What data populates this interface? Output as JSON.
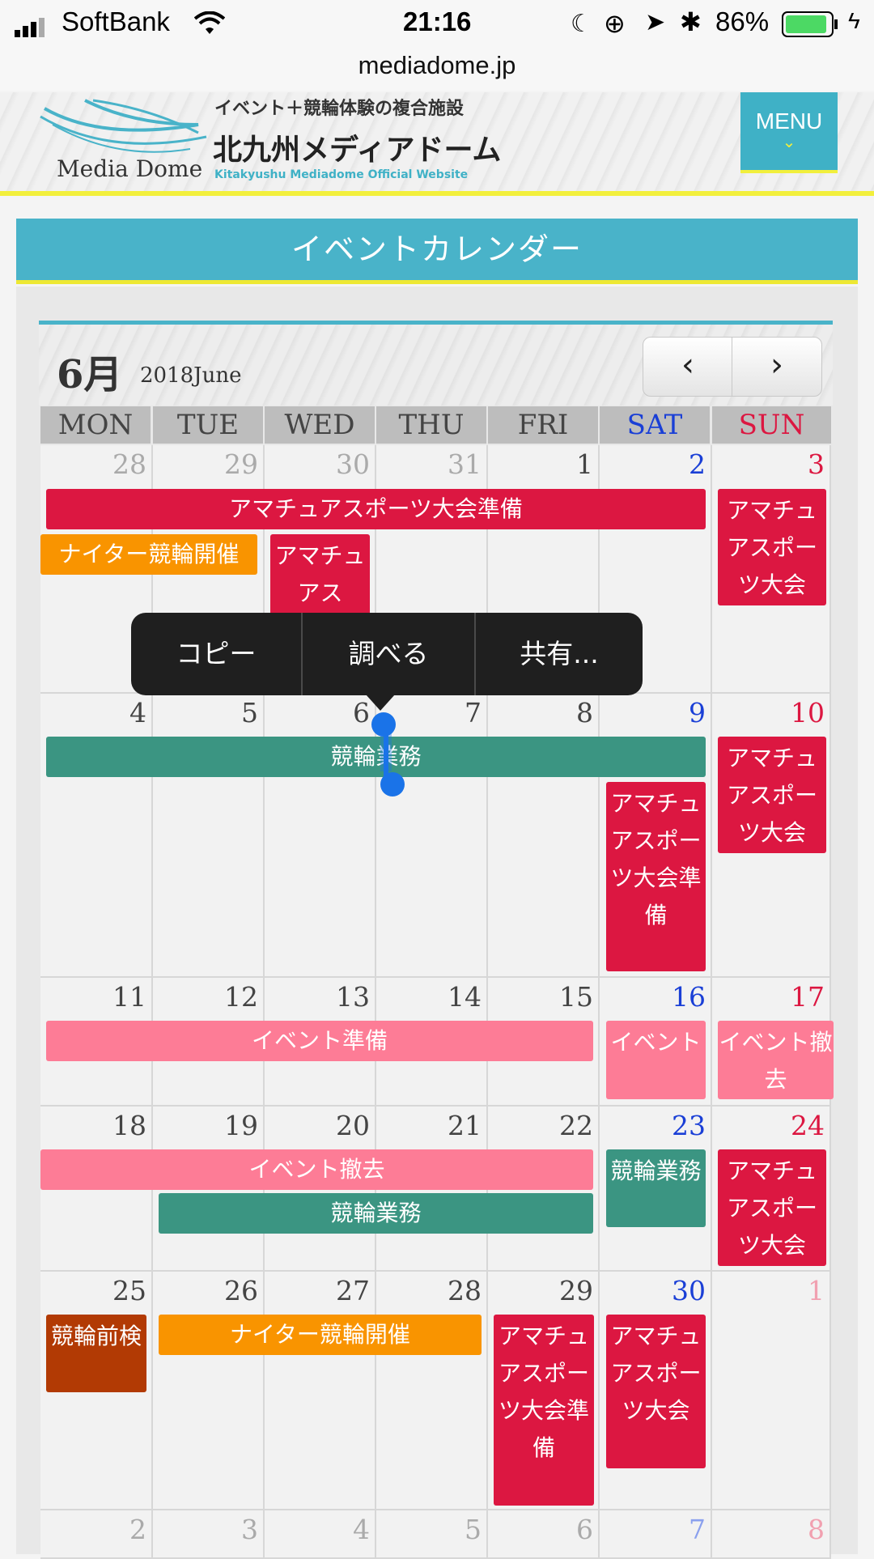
{
  "status": {
    "carrier": "SoftBank",
    "time": "21:16",
    "battery": "86%"
  },
  "url": "mediadome.jp",
  "header": {
    "logo_text": "Media Dome",
    "tagline": "イベント＋競輪体験の複合施設",
    "site_name": "北九州メディアドーム",
    "site_name_en": "Kitakyushu Mediadome Official Website",
    "menu_label": "MENU"
  },
  "section_title": "イベントカレンダー",
  "calendar": {
    "month": "6月",
    "year_label": "2018June",
    "prev": "‹",
    "next": "›",
    "weekdays": [
      "MON",
      "TUE",
      "WED",
      "THU",
      "FRI",
      "SAT",
      "SUN"
    ],
    "weeks": [
      [
        "28",
        "29",
        "30",
        "31",
        "1",
        "2",
        "3"
      ],
      [
        "4",
        "5",
        "6",
        "7",
        "8",
        "9",
        "10"
      ],
      [
        "11",
        "12",
        "13",
        "14",
        "15",
        "16",
        "17"
      ],
      [
        "18",
        "19",
        "20",
        "21",
        "22",
        "23",
        "24"
      ],
      [
        "25",
        "26",
        "27",
        "28",
        "29",
        "30",
        "1"
      ],
      [
        "2",
        "3",
        "4",
        "5",
        "6",
        "7",
        "8"
      ]
    ],
    "events": {
      "e1": "アマチュアスポーツ大会準備",
      "e2": "アマチュアスポーツ大会",
      "e3": "ナイター競輪開催",
      "e4": "アマチュアス",
      "e5": "競輪業務",
      "e6": "アマチュアスポーツ大会準備",
      "e7": "アマチュアスポーツ大会",
      "e8": "イベント準備",
      "e9": "イベント",
      "e10": "イベント撤去",
      "e11": "イベント撤去",
      "e12": "競輪業務",
      "e13": "競輪業務",
      "e14": "アマチュアスポーツ大会",
      "e15": "競輪前検",
      "e16": "ナイター競輪開催",
      "e17": "アマチュアスポーツ大会準備",
      "e18": "アマチュアスポーツ大会"
    }
  },
  "popup": {
    "copy": "コピー",
    "lookup": "調べる",
    "share": "共有..."
  },
  "colors": {
    "teal": "#49b3c9",
    "yellow": "#ede833",
    "sat": "#1a3fd6",
    "sun": "#dc1741"
  }
}
